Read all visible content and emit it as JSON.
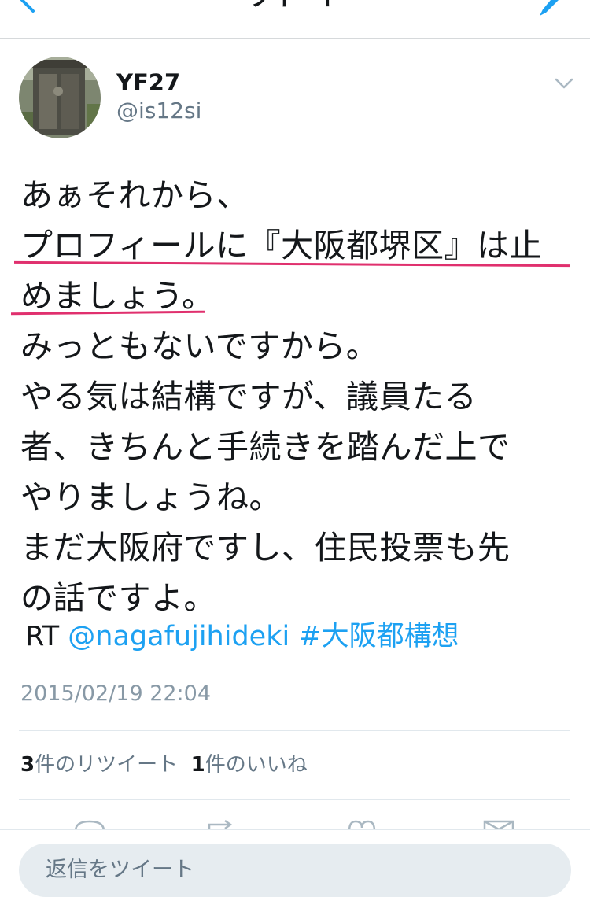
{
  "header": {
    "title": "ツイート",
    "back_icon": "chevron-left-icon",
    "compose_icon": "compose-icon"
  },
  "tweet": {
    "display_name": "YF27",
    "handle": "@is12si",
    "lines": [
      "あぁそれから、",
      "プロフィールに『大阪都堺区』は止",
      "めましょう。",
      "みっともないですから。",
      "やる気は結構ですが、議員たる",
      "者、きちんと手続きを踏んだ上で",
      "やりましょうね。",
      "まだ大阪府ですし、住民投票も先",
      "の話ですよ。"
    ],
    "rt_prefix": "RT",
    "mention": "@nagafujihideki",
    "hashtag": "#大阪都構想",
    "timestamp": "2015/02/19 22:04",
    "retweet_count": "3",
    "retweet_label": "件のリツイート",
    "like_count": "1",
    "like_label": "件のいいね"
  },
  "reply": {
    "placeholder": "返信をツイート"
  },
  "colors": {
    "link": "#1da1f2",
    "underline": "#e0306e",
    "muted": "#657786"
  }
}
